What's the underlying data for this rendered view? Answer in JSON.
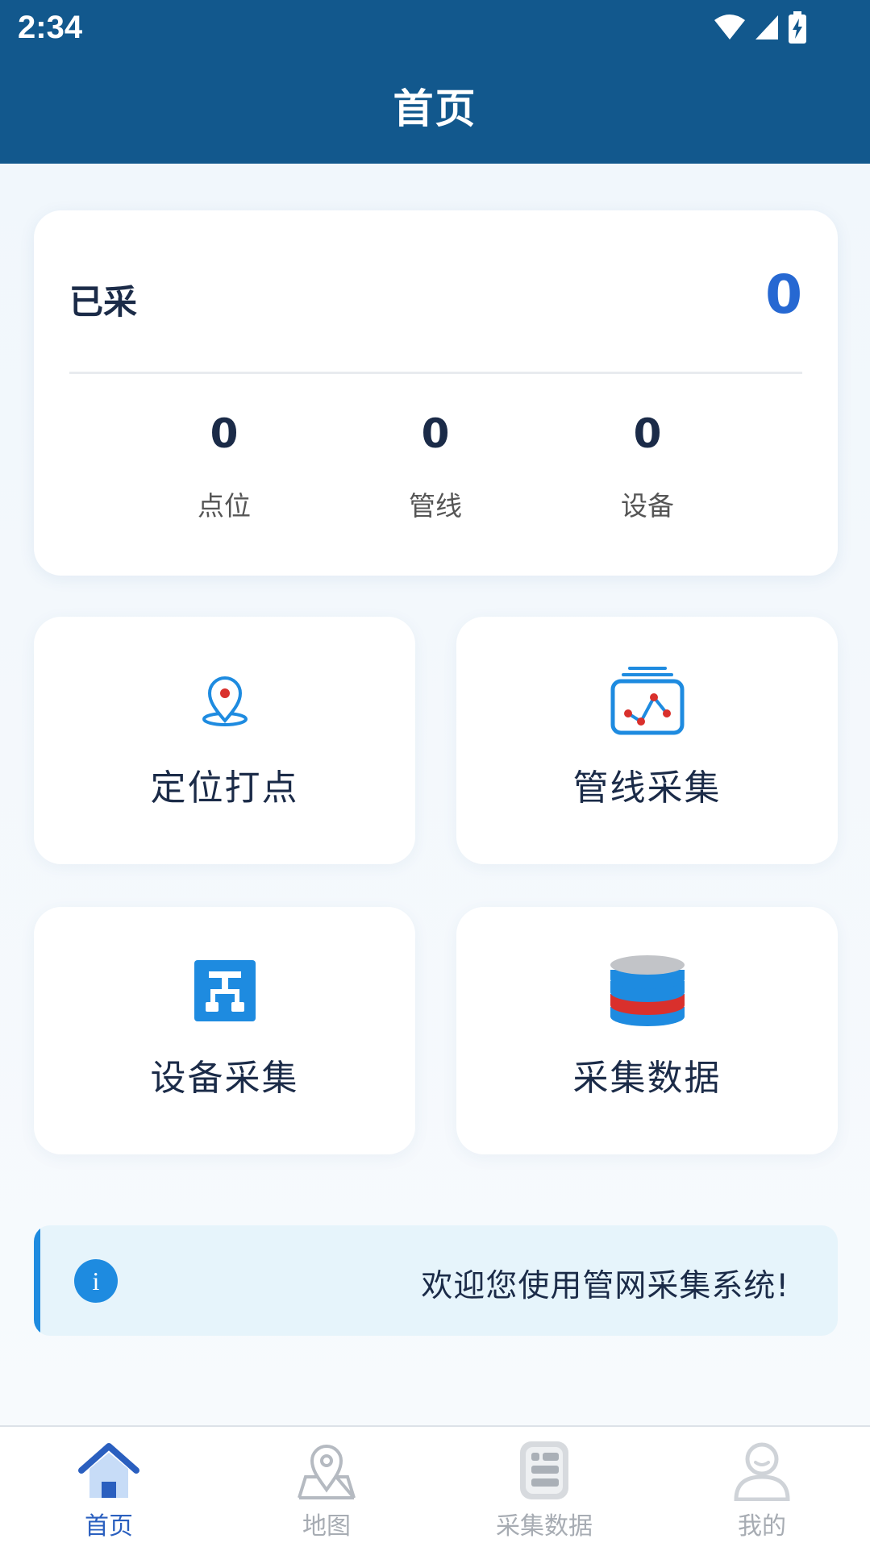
{
  "status_bar": {
    "time": "2:34"
  },
  "header": {
    "title": "首页"
  },
  "summary": {
    "label": "已采",
    "total": "0",
    "stats": [
      {
        "value": "0",
        "label": "点位"
      },
      {
        "value": "0",
        "label": "管线"
      },
      {
        "value": "0",
        "label": "设备"
      }
    ]
  },
  "tiles": [
    {
      "label": "定位打点",
      "icon": "location-pin-icon"
    },
    {
      "label": "管线采集",
      "icon": "pipeline-chart-icon"
    },
    {
      "label": "设备采集",
      "icon": "device-network-icon"
    },
    {
      "label": "采集数据",
      "icon": "database-icon"
    }
  ],
  "notice": {
    "text": "欢迎您使用管网采集系统!"
  },
  "tabbar": {
    "active": "首页",
    "items": [
      {
        "label": "首页",
        "icon": "home-icon"
      },
      {
        "label": "地图",
        "icon": "map-pin-icon"
      },
      {
        "label": "采集数据",
        "icon": "data-list-icon"
      },
      {
        "label": "我的",
        "icon": "user-icon"
      }
    ]
  },
  "colors": {
    "header_bg": "#12588d",
    "accent": "#2668d2",
    "notice_bg": "#e6f4fb",
    "notice_accent": "#1e8be0",
    "tab_active": "#2a5fbf",
    "tab_inactive": "#a7acb3"
  }
}
